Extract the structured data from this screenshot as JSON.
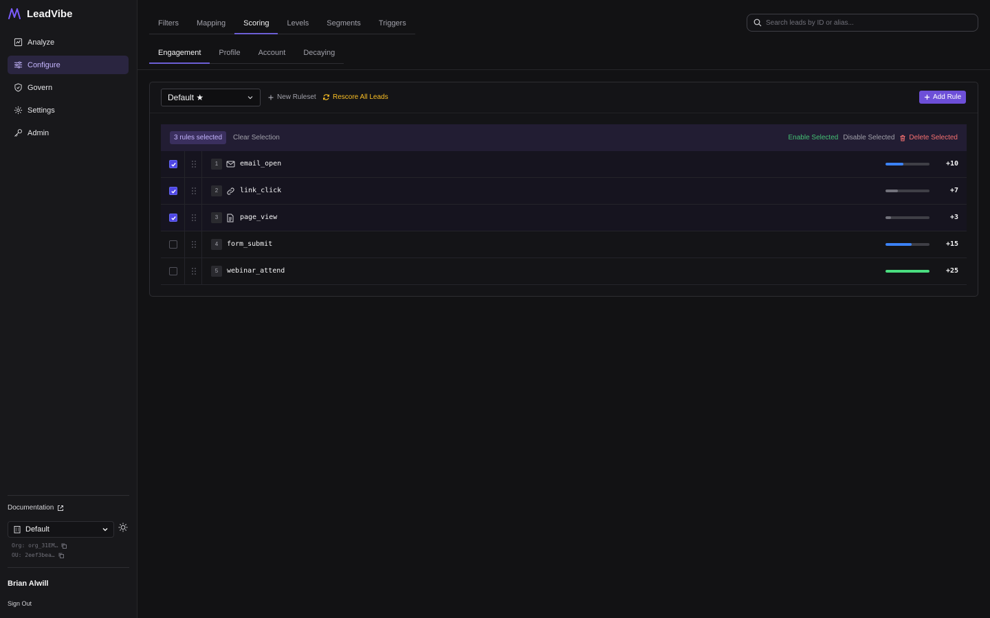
{
  "brand": {
    "name": "LeadVibe",
    "accent": "#7c5cff"
  },
  "sidebar": {
    "items": [
      {
        "label": "Analyze",
        "icon": "chart-box-icon"
      },
      {
        "label": "Configure",
        "icon": "sliders-icon",
        "active": true
      },
      {
        "label": "Govern",
        "icon": "shield-icon"
      },
      {
        "label": "Settings",
        "icon": "gear-icon"
      },
      {
        "label": "Admin",
        "icon": "key-icon"
      }
    ],
    "documentation": "Documentation",
    "ou_select": "Default",
    "org_line": "Org: org_31EM…",
    "ou_line": "OU: 2eef3bea…",
    "user_name": "Brian Alwill",
    "sign_out": "Sign Out"
  },
  "tabs": [
    "Filters",
    "Mapping",
    "Scoring",
    "Levels",
    "Segments",
    "Triggers"
  ],
  "active_tab": "Scoring",
  "subtabs": [
    "Engagement",
    "Profile",
    "Account",
    "Decaying"
  ],
  "active_subtab": "Engagement",
  "search": {
    "placeholder": "Search leads by ID or alias..."
  },
  "toolbar": {
    "ruleset": "Default ★",
    "new_ruleset": "New Ruleset",
    "rescore": "Rescore All Leads",
    "add_rule": "Add Rule"
  },
  "selection": {
    "count_label": "3 rules selected",
    "clear": "Clear Selection",
    "enable": "Enable Selected",
    "disable": "Disable Selected",
    "delete": "Delete Selected"
  },
  "rules": [
    {
      "index": "1",
      "name": "email_open",
      "icon": "mail-icon",
      "score": "+10",
      "checked": true,
      "level": 0.4,
      "bar_color": "#3b82f6"
    },
    {
      "index": "2",
      "name": "link_click",
      "icon": "link-icon",
      "score": "+7",
      "checked": true,
      "level": 0.28,
      "bar_color": "#71717a"
    },
    {
      "index": "3",
      "name": "page_view",
      "icon": "document-icon",
      "score": "+3",
      "checked": true,
      "level": 0.12,
      "bar_color": "#71717a"
    },
    {
      "index": "4",
      "name": "form_submit",
      "icon": "",
      "score": "+15",
      "checked": false,
      "level": 0.6,
      "bar_color": "#3b82f6"
    },
    {
      "index": "5",
      "name": "webinar_attend",
      "icon": "",
      "score": "+25",
      "checked": false,
      "level": 1.0,
      "bar_color": "#4ade80"
    }
  ],
  "colors": {
    "rescore": "#fbbf24",
    "enable": "#4ade80",
    "delete": "#f87171",
    "add_rule_bg": "#6d4fd8"
  }
}
